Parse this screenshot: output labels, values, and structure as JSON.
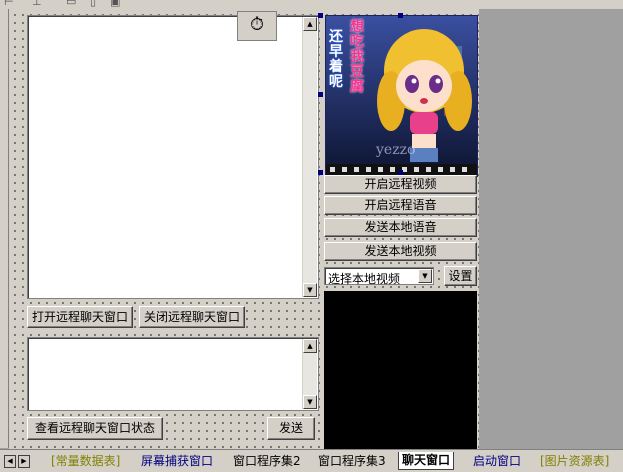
{
  "chat": {
    "open_button": "打开远程聊天窗口",
    "close_button": "关闭远程聊天窗口",
    "status_button": "查看远程聊天窗口状态",
    "send_button": "发送"
  },
  "media": {
    "image_text_1": "还早着呢",
    "image_text_2": "想吃我豆腐",
    "image_text_3": "yezzo",
    "buttons": [
      "开启远程视频",
      "开启远程语音",
      "发送本地语音",
      "发送本地视频"
    ],
    "select_value": "选择本地视频",
    "settings_button": "设置"
  },
  "tabs": [
    {
      "label": "[常量数据表]",
      "color": "#808000",
      "active": false
    },
    {
      "label": "屏幕捕获窗口",
      "color": "#000080",
      "active": false
    },
    {
      "label": "窗口程序集2",
      "color": "#000000",
      "active": false
    },
    {
      "label": "窗口程序集3",
      "color": "#000000",
      "active": false
    },
    {
      "label": "聊天窗口",
      "color": "#000000",
      "active": true
    },
    {
      "label": "启动窗口",
      "color": "#000080",
      "active": false
    },
    {
      "label": "[图片资源表]",
      "color": "#808000",
      "active": false
    }
  ],
  "colors": {
    "accent": "#000080",
    "form_bg": "#d4d0c8",
    "editor_bg": "#a0a0a0"
  }
}
